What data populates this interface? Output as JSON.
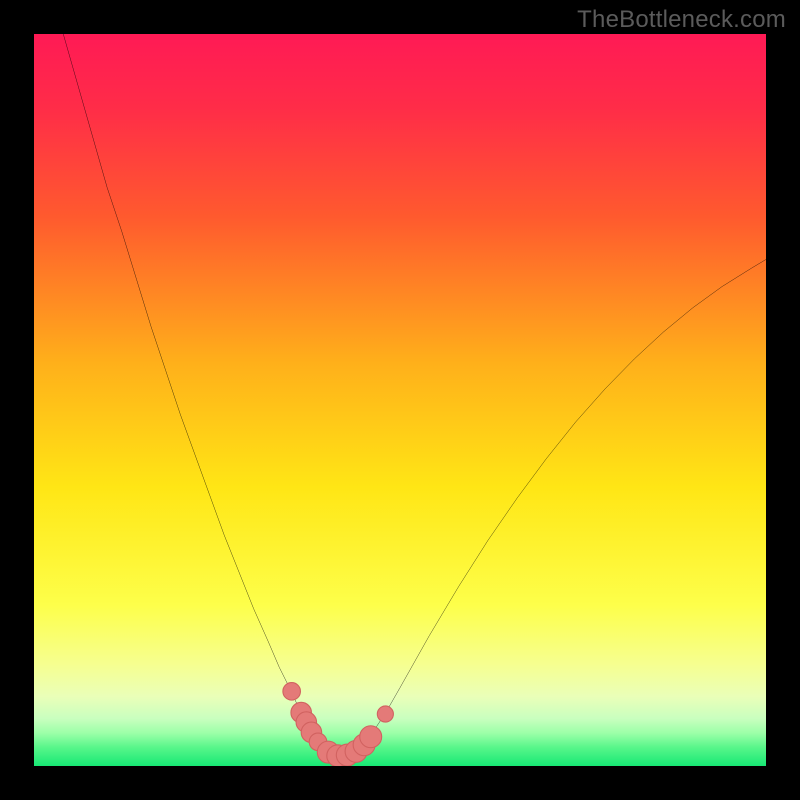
{
  "watermark": "TheBottleneck.com",
  "colors": {
    "frame": "#000000",
    "gradient_stops": [
      {
        "offset": 0.0,
        "color": "#ff1a55"
      },
      {
        "offset": 0.1,
        "color": "#ff2c48"
      },
      {
        "offset": 0.25,
        "color": "#ff5a2e"
      },
      {
        "offset": 0.45,
        "color": "#ffb01a"
      },
      {
        "offset": 0.62,
        "color": "#ffe615"
      },
      {
        "offset": 0.78,
        "color": "#fdff4a"
      },
      {
        "offset": 0.86,
        "color": "#f6ff8f"
      },
      {
        "offset": 0.905,
        "color": "#eaffb8"
      },
      {
        "offset": 0.935,
        "color": "#c9ffbf"
      },
      {
        "offset": 0.955,
        "color": "#9cffa8"
      },
      {
        "offset": 0.975,
        "color": "#57f68a"
      },
      {
        "offset": 1.0,
        "color": "#17e874"
      }
    ],
    "curve": "#000000",
    "marker_fill": "#e47a78",
    "marker_stroke": "#d16260"
  },
  "chart_data": {
    "type": "line",
    "title": "",
    "xlabel": "",
    "ylabel": "",
    "xlim": [
      0,
      100
    ],
    "ylim": [
      0,
      100
    ],
    "series": [
      {
        "name": "bottleneck-curve",
        "x": [
          4,
          6,
          8,
          10,
          12,
          14,
          16,
          18,
          20,
          22,
          24,
          26,
          28,
          30,
          32,
          33.5,
          35,
          36,
          37,
          38,
          39,
          40,
          41,
          42,
          43,
          44.5,
          46,
          48,
          50,
          54,
          58,
          62,
          66,
          70,
          74,
          78,
          82,
          86,
          90,
          94,
          98,
          100
        ],
        "y": [
          100,
          93,
          86,
          79,
          73,
          66.5,
          60,
          54,
          48,
          42.5,
          37,
          31.5,
          26.5,
          21.5,
          17,
          13.5,
          10.5,
          8.3,
          6.5,
          4.8,
          3.4,
          2.3,
          1.6,
          1.4,
          1.7,
          2.6,
          4.2,
          7.2,
          10.7,
          17.8,
          24.5,
          30.8,
          36.6,
          42,
          47,
          51.5,
          55.6,
          59.3,
          62.6,
          65.5,
          68,
          69.2
        ]
      }
    ],
    "markers": {
      "name": "highlight-points",
      "points": [
        {
          "x": 35.2,
          "y": 10.2,
          "r": 1.2
        },
        {
          "x": 36.5,
          "y": 7.3,
          "r": 1.4
        },
        {
          "x": 37.2,
          "y": 6.0,
          "r": 1.4
        },
        {
          "x": 37.9,
          "y": 4.6,
          "r": 1.4
        },
        {
          "x": 38.8,
          "y": 3.3,
          "r": 1.2
        },
        {
          "x": 40.2,
          "y": 1.9,
          "r": 1.5
        },
        {
          "x": 41.5,
          "y": 1.4,
          "r": 1.5
        },
        {
          "x": 42.8,
          "y": 1.5,
          "r": 1.5
        },
        {
          "x": 44.0,
          "y": 2.0,
          "r": 1.5
        },
        {
          "x": 45.1,
          "y": 2.9,
          "r": 1.5
        },
        {
          "x": 46.0,
          "y": 4.0,
          "r": 1.5
        },
        {
          "x": 48.0,
          "y": 7.1,
          "r": 1.1
        }
      ]
    }
  }
}
